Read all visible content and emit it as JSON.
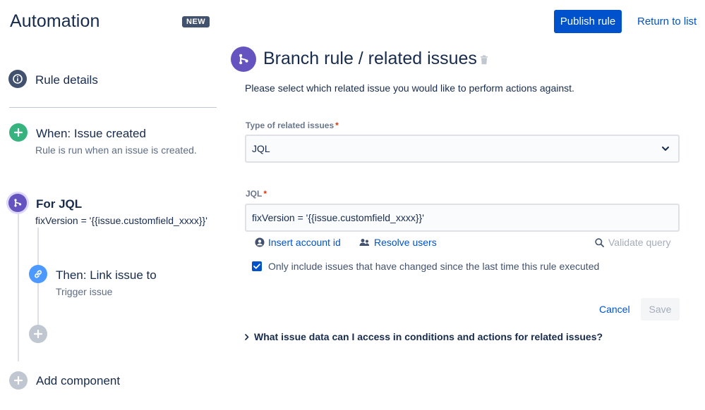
{
  "header": {
    "app_title": "Automation",
    "new_badge": "NEW",
    "publish_label": "Publish rule",
    "return_label": "Return to list"
  },
  "sidebar": {
    "rule_details": "Rule details",
    "trigger": {
      "title": "When: Issue created",
      "subtitle": "Rule is run when an issue is created."
    },
    "branch": {
      "title": "For JQL",
      "subtitle": "fixVersion = '{{issue.customfield_xxxx}}'"
    },
    "action": {
      "title": "Then: Link issue to",
      "subtitle": "Trigger issue"
    },
    "add_component": "Add component"
  },
  "main": {
    "title": "Branch rule / related issues",
    "description": "Please select which related issue you would like to perform actions against.",
    "type_label": "Type of related issues",
    "type_value": "JQL",
    "jql_label": "JQL",
    "jql_value": "fixVersion = '{{issue.customfield_xxxx}}'",
    "insert_account_id": "Insert account id",
    "resolve_users": "Resolve users",
    "validate_query": "Validate query",
    "checkbox_label": "Only include issues that have changed since the last time this rule executed",
    "checkbox_checked": true,
    "cancel_label": "Cancel",
    "save_label": "Save",
    "expander_label": "What issue data can I access in conditions and actions for related issues?"
  },
  "colors": {
    "primary": "#0052cc",
    "trigger_green": "#36b37e",
    "branch_purple": "#6554c0",
    "action_blue": "#4c9aff",
    "required_red": "#de350b"
  }
}
